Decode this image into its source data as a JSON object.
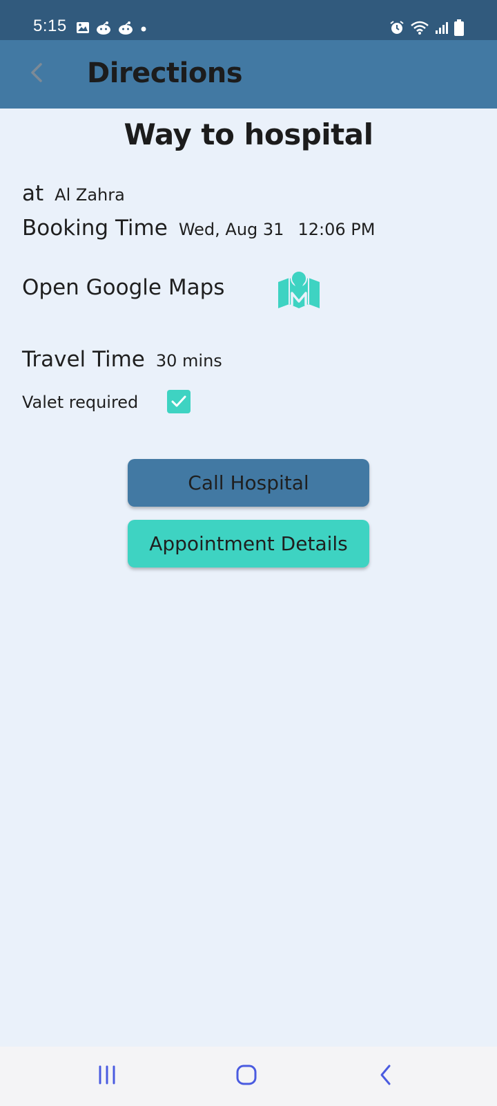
{
  "status_bar": {
    "time": "5:15",
    "left_icons": [
      "image-icon",
      "reddit-icon",
      "reddit-icon",
      "dot-icon"
    ],
    "right_icons": [
      "alarm-icon",
      "wifi-icon",
      "signal-icon",
      "battery-icon"
    ]
  },
  "app_bar": {
    "title": "Directions",
    "back_icon": "chevron-left-icon"
  },
  "main": {
    "heading": "Way to hospital",
    "at_label": "at",
    "hospital_name": "Al Zahra",
    "booking_label": "Booking Time",
    "booking_date": "Wed, Aug 31",
    "booking_time": "12:06 PM",
    "maps_label": "Open Google Maps",
    "maps_icon": "map-marker-icon",
    "travel_label": "Travel Time",
    "travel_value": "30 mins",
    "valet_label": "Valet required",
    "valet_checked": true
  },
  "buttons": {
    "call": "Call Hospital",
    "appointment": "Appointment Details"
  },
  "nav_bar": {
    "icons": [
      "recents-icon",
      "home-icon",
      "back-icon"
    ]
  },
  "colors": {
    "status_bar": "#315a7d",
    "app_bar": "#4279a3",
    "background": "#eaf1fa",
    "accent": "#3ed3c2",
    "nav_icon": "#4a5be0"
  }
}
